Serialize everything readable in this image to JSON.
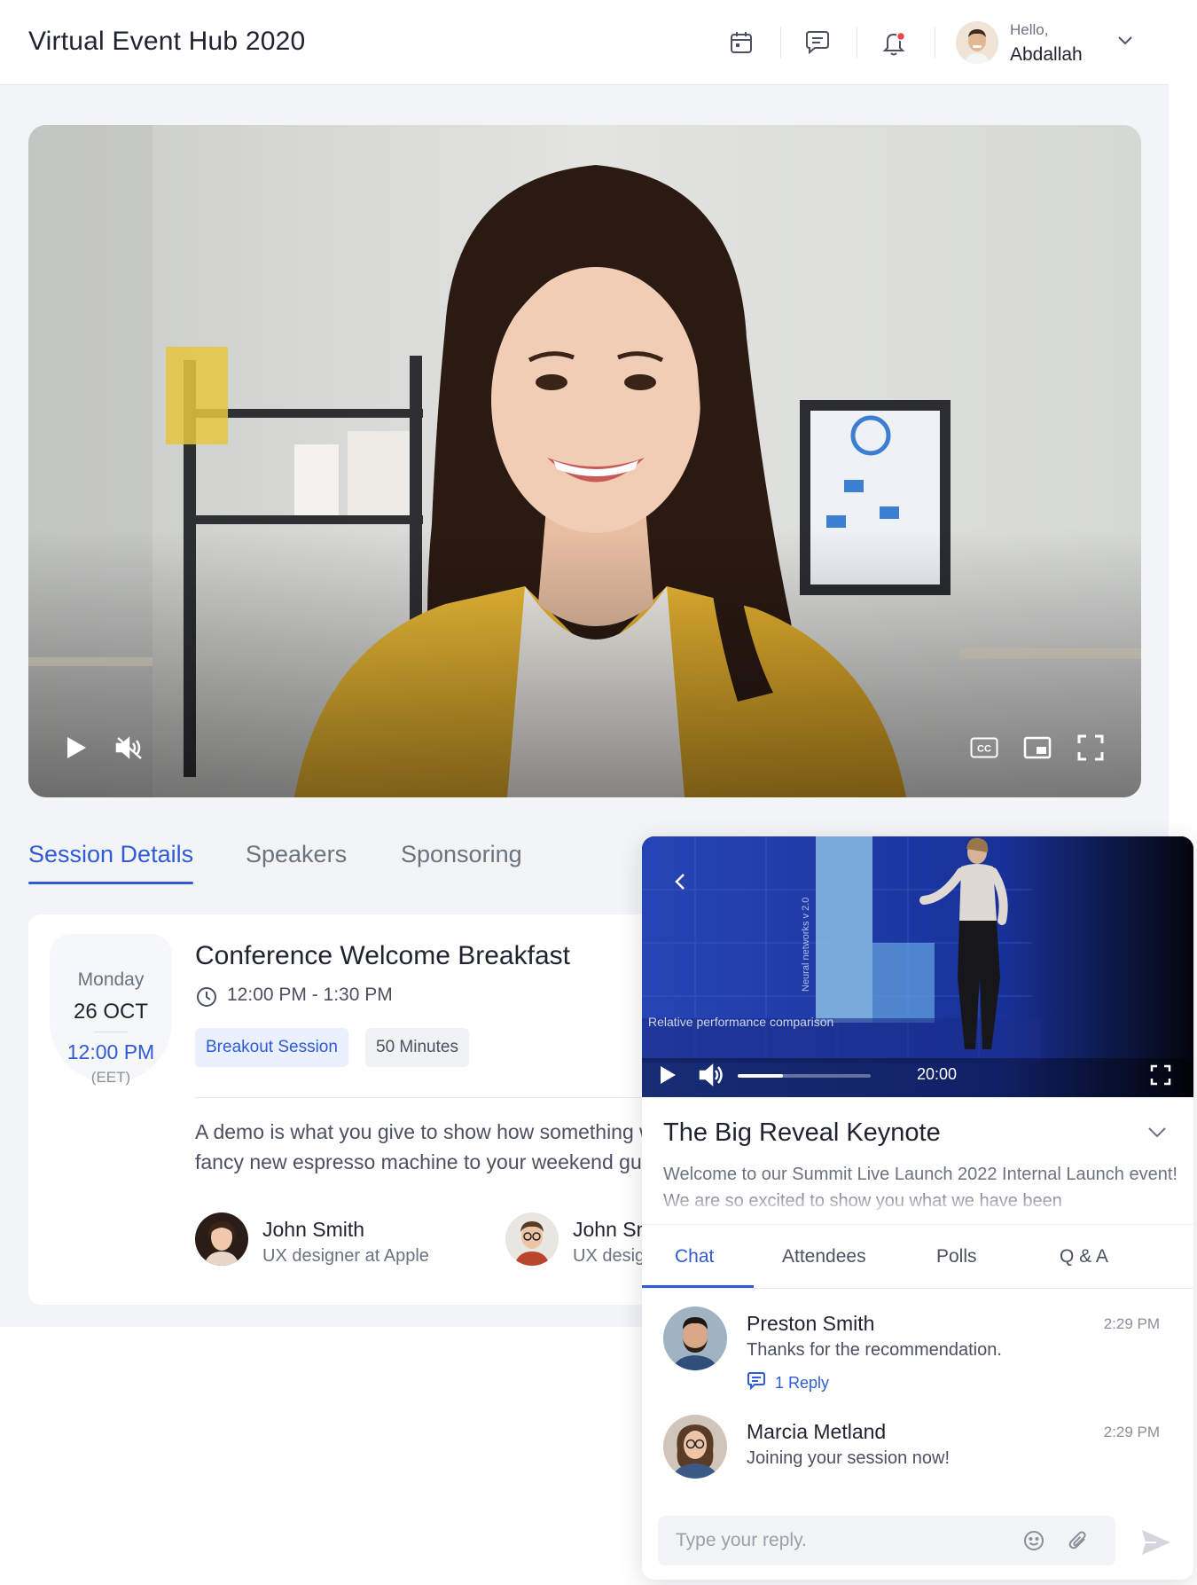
{
  "header": {
    "title": "Virtual Event Hub 2020",
    "greeting": "Hello,",
    "user_name": "Abdallah"
  },
  "main_video": {
    "controls": [
      "play-icon",
      "mute-icon",
      "cc-icon",
      "pip-icon",
      "fullscreen-icon"
    ],
    "cc_label": "CC"
  },
  "tabs": [
    {
      "label": "Session Details",
      "active": true
    },
    {
      "label": "Speakers",
      "active": false
    },
    {
      "label": "Sponsoring",
      "active": false
    }
  ],
  "session": {
    "day": "Monday",
    "date": "26 OCT",
    "time": "12:00 PM",
    "timezone": "(EET)",
    "title": "Conference Welcome Breakfast",
    "time_range": "12:00 PM - 1:30 PM",
    "type_badge": "Breakout Session",
    "duration_badge": "50 Minutes",
    "description": "A demo is what you give to show how something works, like when you show off your fancy new espresso machine to your weekend guests.",
    "speakers": [
      {
        "name": "John Smith",
        "role": "UX designer at Apple"
      },
      {
        "name": "John Smith",
        "role": "UX designer at Apple"
      }
    ]
  },
  "mini_player": {
    "slide_caption": "Relative performance comparison",
    "slide_axis_label": "Neural networks v 2.0",
    "time": "20:00",
    "progress_fraction": 0.34,
    "title": "The Big Reveal Keynote",
    "description": "Welcome to our Summit Live Launch 2022 Internal Launch event! We are so excited to show you what we have been"
  },
  "panel_tabs": [
    {
      "label": "Chat",
      "active": true
    },
    {
      "label": "Attendees",
      "active": false
    },
    {
      "label": "Polls",
      "active": false
    },
    {
      "label": "Q & A",
      "active": false
    }
  ],
  "messages": [
    {
      "name": "Preston Smith",
      "time": "2:29 PM",
      "text": "Thanks for the recommendation.",
      "reply": "1 Reply"
    },
    {
      "name": "Marcia Metland",
      "time": "2:29 PM",
      "text": "Joining your session now!"
    }
  ],
  "composer": {
    "placeholder": "Type your reply."
  },
  "colors": {
    "accent": "#2f5bd8",
    "notification_dot": "#e5484d"
  }
}
